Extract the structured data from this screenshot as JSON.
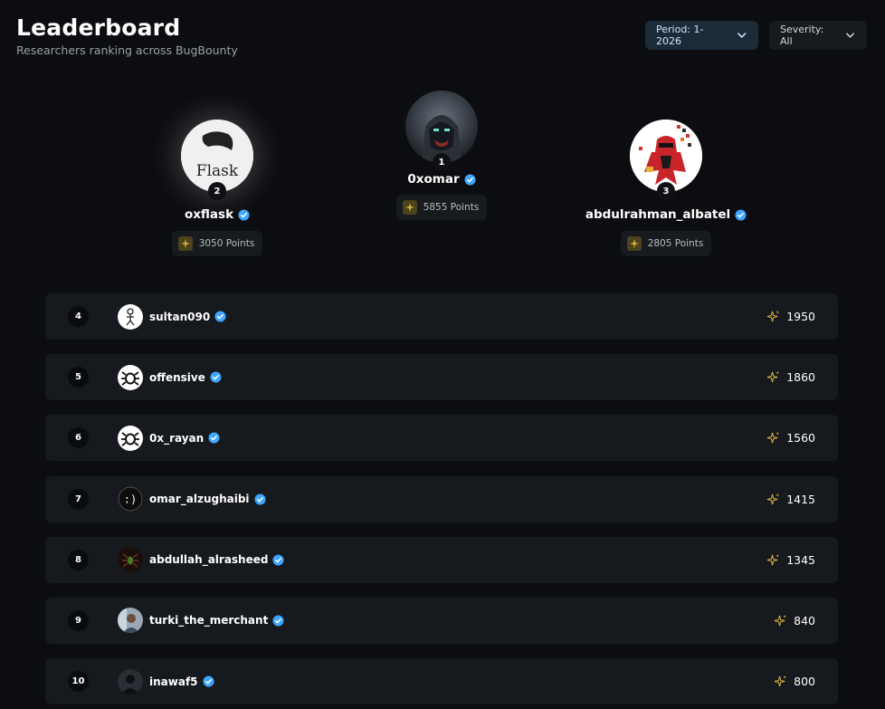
{
  "header": {
    "title": "Leaderboard",
    "subtitle": "Researchers ranking across BugBounty"
  },
  "filters": {
    "period_label": "Period: 1-2026",
    "severity_label": "Severity: All"
  },
  "podium": [
    {
      "rank": "1",
      "name": "0xomar",
      "points": "5855 Points",
      "avatar": "hooded-figure-avatar"
    },
    {
      "rank": "2",
      "name": "oxflask",
      "points": "3050 Points",
      "avatar": "flask-logo-avatar"
    },
    {
      "rank": "3",
      "name": "abdulrahman_albatel",
      "points": "2805 Points",
      "avatar": "red-ninja-avatar"
    }
  ],
  "rows": [
    {
      "rank": "4",
      "name": "sultan090",
      "score": "1950",
      "avatar": "stick-figure-avatar"
    },
    {
      "rank": "5",
      "name": "offensive",
      "score": "1860",
      "avatar": "bug-avatar"
    },
    {
      "rank": "6",
      "name": "0x_rayan",
      "score": "1560",
      "avatar": "bug-avatar"
    },
    {
      "rank": "7",
      "name": "omar_alzughaibi",
      "score": "1415",
      "avatar": "smiley-avatar"
    },
    {
      "rank": "8",
      "name": "abdullah_alrasheed",
      "score": "1345",
      "avatar": "spider-avatar"
    },
    {
      "rank": "9",
      "name": "turki_the_merchant",
      "score": "840",
      "avatar": "photo-avatar"
    },
    {
      "rank": "10",
      "name": "inawaf5",
      "score": "800",
      "avatar": "dark-figure-avatar"
    }
  ],
  "colors": {
    "background": "#0b0d10",
    "row_bg": "#16191d",
    "verified_blue": "#3ea6ff",
    "points_gold": "#d9b23a"
  }
}
